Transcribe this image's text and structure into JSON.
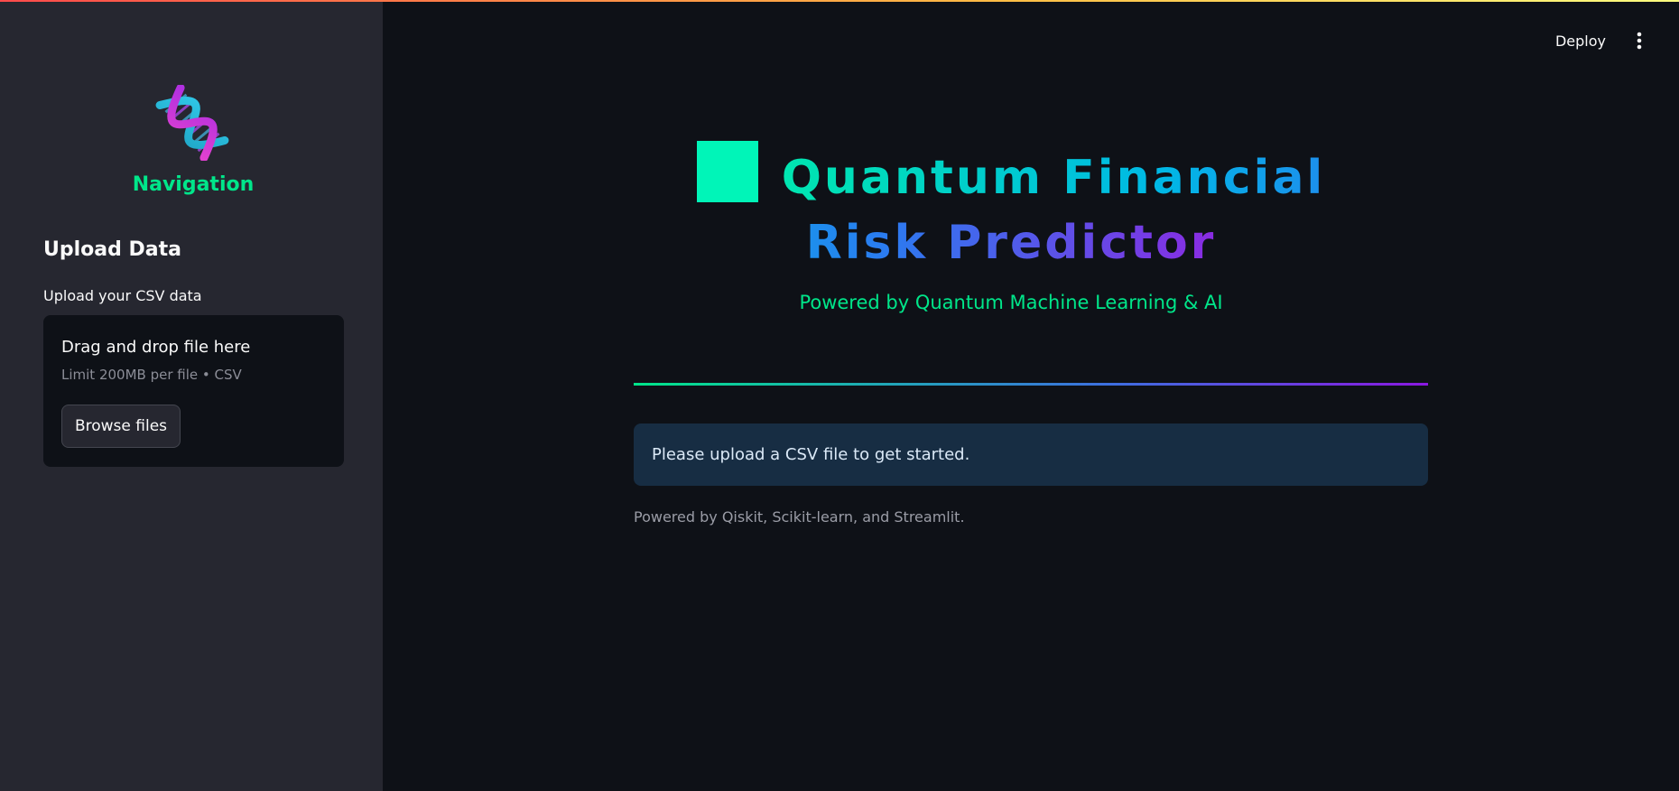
{
  "sidebar": {
    "logo_icon": "dna-helix-icon",
    "nav_title": "Navigation",
    "upload_heading": "Upload Data",
    "upload_label": "Upload your CSV data",
    "dropzone": {
      "title": "Drag and drop file here",
      "subtitle": "Limit 200MB per file • CSV",
      "browse_label": "Browse files"
    }
  },
  "header": {
    "deploy_label": "Deploy",
    "menu_icon": "kebab-menu-icon"
  },
  "main": {
    "title": "Quantum Financial Risk Predictor",
    "title_icon": "green-square-icon",
    "subtitle": "Powered by Quantum Machine Learning & AI",
    "info_message": "Please upload a CSV file to get started.",
    "footer": "Powered by Qiskit, Scikit-learn, and Streamlit."
  },
  "colors": {
    "background": "#0e1117",
    "sidebar": "#262730",
    "accent_green": "#00e68a",
    "info_bg": "#172d43",
    "gradient_start": "#00e6b0",
    "gradient_end": "#8a2be2"
  }
}
